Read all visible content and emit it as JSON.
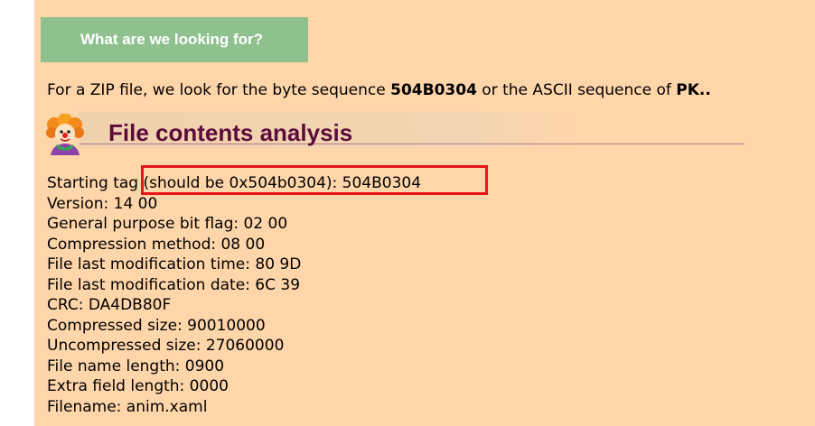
{
  "section_button": {
    "label": "What are we looking for?"
  },
  "intro": {
    "prefix": "For a ZIP file, we look for the byte sequence ",
    "hex_sequence": "504B0304",
    "middle": " or the ASCII sequence of ",
    "ascii_sequence": "PK.."
  },
  "analysis": {
    "title": "File contents analysis",
    "icon": "clown-icon",
    "rows": [
      "Starting tag (should be 0x504b0304): 504B0304",
      "Version: 14 00",
      "General purpose bit flag: 02 00",
      "Compression method: 08 00",
      "File last modification time: 80 9D",
      "File last modification date: 6C 39",
      "CRC: DA4DB80F",
      "Compressed size: 90010000",
      "Uncompressed size: 27060000",
      "File name length: 0900",
      "Extra field length: 0000",
      "Filename: anim.xaml"
    ]
  },
  "colors": {
    "panel_background": "#ffd5aa",
    "button_background": "#8fc18f",
    "heading_text": "#5c0b3a",
    "highlight_border": "#e8141b"
  }
}
